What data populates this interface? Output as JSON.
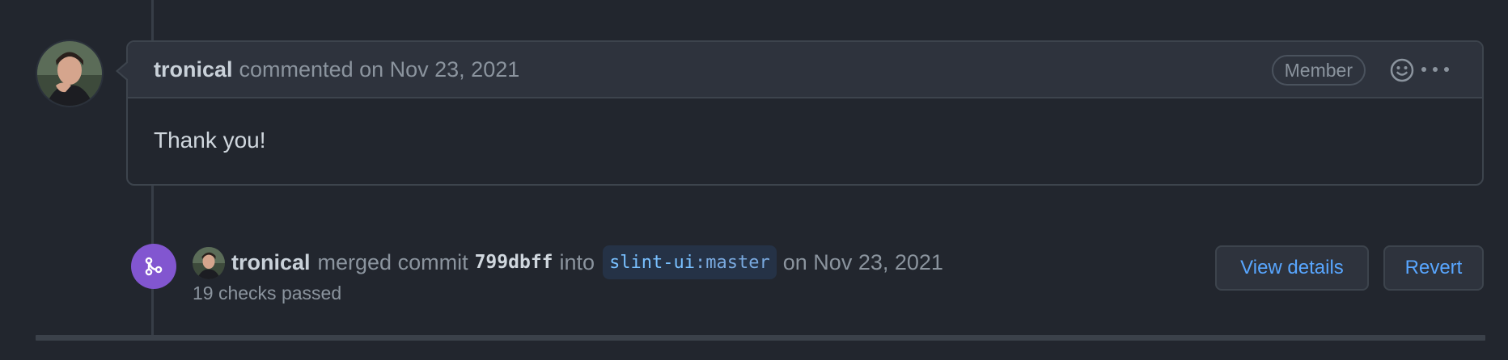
{
  "comment": {
    "author": "tronical",
    "action_text": "commented on Nov 23, 2021",
    "badge": "Member",
    "body": "Thank you!"
  },
  "merge_event": {
    "author": "tronical",
    "text_before_commit": "merged commit",
    "commit_hash": "799dbff",
    "text_into": "into",
    "branch_repo": "slint-ui",
    "branch_separator": ":",
    "branch_name": "master",
    "date_text": "on Nov 23, 2021",
    "checks_text": "19 checks passed"
  },
  "buttons": {
    "view_details": "View details",
    "revert": "Revert"
  },
  "icons": {
    "reaction": "smiley-icon",
    "more": "kebab-horizontal-icon",
    "merge": "git-merge-icon"
  },
  "colors": {
    "background": "#22262e",
    "comment_header": "#2e333d",
    "border": "#3d444d",
    "accent_blue": "#58a6ff",
    "merge_purple": "#8256d0"
  }
}
